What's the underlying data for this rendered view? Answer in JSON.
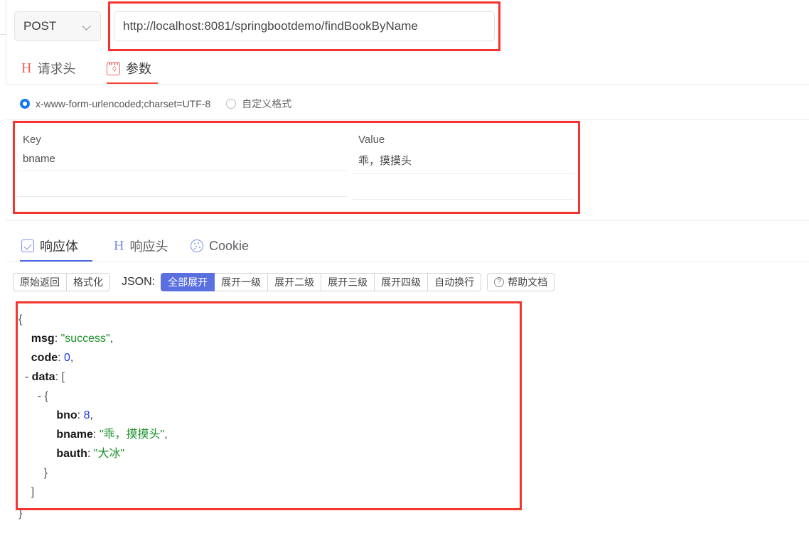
{
  "request": {
    "method": "POST",
    "method_icon": "chevron-down-icon",
    "url": "http://localhost:8081/springbootdemo/findBookByName",
    "url_placeholder": "http://localhost:8081/springbootdemo/findBookByName",
    "tabs": [
      {
        "label": "请求头",
        "icon": "header-h-icon",
        "active": false
      },
      {
        "label": "参数",
        "icon": "code-brackets-icon",
        "active": true
      }
    ],
    "encoding_options": [
      {
        "label": "x-www-form-urlencoded;charset=UTF-8",
        "selected": true
      },
      {
        "label": "自定义格式",
        "selected": false
      }
    ],
    "params_table": {
      "columns": [
        "Key",
        "Value"
      ],
      "rows": [
        {
          "key": "bname",
          "value": "乖，摸摸头"
        },
        {
          "key": "",
          "value": ""
        }
      ]
    }
  },
  "response": {
    "tabs": [
      {
        "label": "响应体",
        "icon": "checkbox-icon",
        "active": true
      },
      {
        "label": "响应头",
        "icon": "header-h-icon",
        "active": false
      },
      {
        "label": "Cookie",
        "icon": "cookie-icon",
        "active": false
      }
    ],
    "toolbar": {
      "raw_label": "原始返回",
      "format_label": "格式化",
      "json_label": "JSON:",
      "expand_all": "全部展开",
      "expand_1": "展开一级",
      "expand_2": "展开二级",
      "expand_3": "展开三级",
      "expand_4": "展开四级",
      "wrap_label": "自动换行",
      "help_label": "帮助文档",
      "help_icon": "question-circle-icon",
      "active_button": "全部展开"
    },
    "json": {
      "open_brace": "{",
      "lines": [
        {
          "indent": 1,
          "toggle": "",
          "key": "msg",
          "sep": ": ",
          "value": "\"success\"",
          "vtype": "string",
          "comma": ","
        },
        {
          "indent": 1,
          "toggle": "",
          "key": "code",
          "sep": ": ",
          "value": "0",
          "vtype": "number",
          "comma": ","
        },
        {
          "indent": 1,
          "toggle": "-",
          "key": "data",
          "sep": ": ",
          "value": "[",
          "vtype": "brace",
          "comma": ""
        },
        {
          "indent": 2,
          "toggle": "-",
          "key": "",
          "sep": "",
          "value": "{",
          "vtype": "brace",
          "comma": ""
        },
        {
          "indent": 3,
          "toggle": "",
          "key": "bno",
          "sep": ": ",
          "value": "8",
          "vtype": "number",
          "comma": ","
        },
        {
          "indent": 3,
          "toggle": "",
          "key": "bname",
          "sep": ": ",
          "value": "\"乖，摸摸头\"",
          "vtype": "string",
          "comma": ","
        },
        {
          "indent": 3,
          "toggle": "",
          "key": "bauth",
          "sep": ": ",
          "value": "\"大冰\"",
          "vtype": "string",
          "comma": ""
        },
        {
          "indent": 2,
          "toggle": "",
          "key": "",
          "sep": "",
          "value": "}",
          "vtype": "brace",
          "comma": ""
        },
        {
          "indent": 1,
          "toggle": "",
          "key": "",
          "sep": "",
          "value": "]",
          "vtype": "brace",
          "comma": ""
        }
      ],
      "close_brace": "}"
    }
  },
  "annotations": {
    "highlight_color": "#f4342e",
    "boxes": [
      "url-field",
      "params-table",
      "response-json-body"
    ]
  }
}
